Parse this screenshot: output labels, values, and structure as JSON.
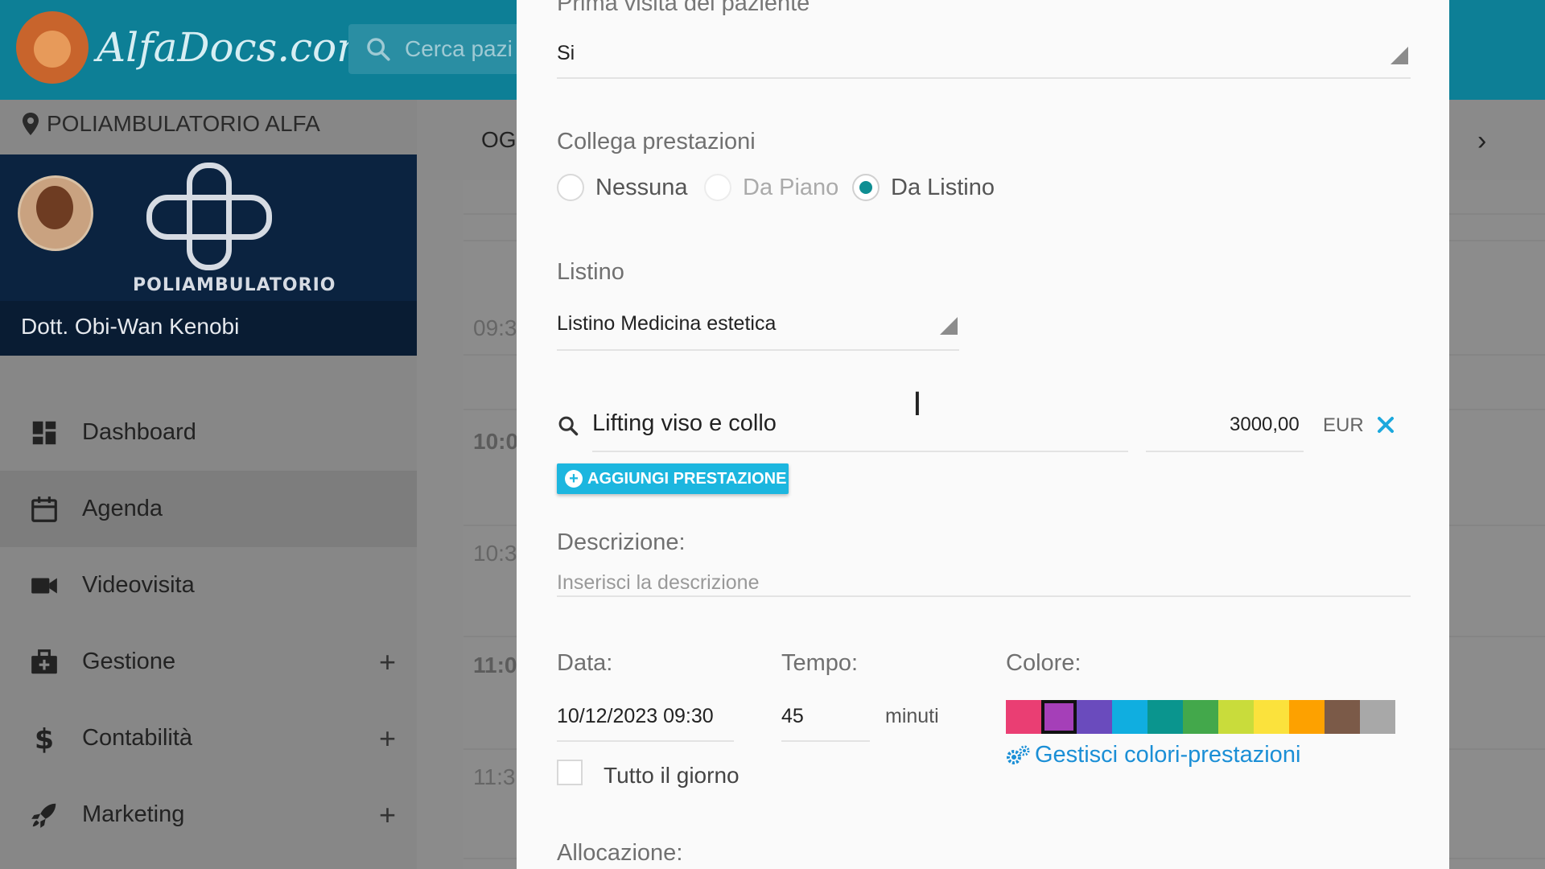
{
  "app": {
    "brand": "AlfaDocs.com",
    "search_placeholder": "Cerca pazi",
    "location": "POLIAMBULATORIO ALFA",
    "clinic_logo_text": "POLIAMBULATORIO",
    "doctor": "Dott. Obi-Wan Kenobi",
    "tab_today": "OGG",
    "nav": [
      {
        "label": "Dashboard",
        "icon": "dashboard-icon"
      },
      {
        "label": "Agenda",
        "icon": "calendar-icon"
      },
      {
        "label": "Videovisita",
        "icon": "video-icon"
      },
      {
        "label": "Gestione",
        "icon": "medical-bag-icon"
      },
      {
        "label": "Contabilità",
        "icon": "dollar-icon"
      },
      {
        "label": "Marketing",
        "icon": "rocket-icon"
      }
    ],
    "times": [
      "09:3",
      "10:0",
      "10:3",
      "11:0",
      "11:3"
    ]
  },
  "form": {
    "first_visit_label": "Prima visita del paziente",
    "first_visit_value": "Si",
    "link_services_label": "Collega prestazioni",
    "radio_options": [
      "Nessuna",
      "Da Piano",
      "Da Listino"
    ],
    "radio_selected": "Da Listino",
    "pricelist_label": "Listino",
    "pricelist_value": "Listino Medicina estetica",
    "service_name": "Lifting viso e collo",
    "service_price": "3000,00",
    "service_currency": "EUR",
    "add_service_button": "AGGIUNGI PRESTAZIONE",
    "description_label": "Descrizione:",
    "description_placeholder": "Inserisci la descrizione",
    "date_label": "Data:",
    "date_value": "10/12/2023 09:30",
    "time_label": "Tempo:",
    "time_value": "45",
    "time_unit": "minuti",
    "color_label": "Colore:",
    "colors": [
      "#ea3e73",
      "#a53fb8",
      "#6a4bbd",
      "#10aee0",
      "#0a958e",
      "#43a84b",
      "#c9dc3b",
      "#fbe23c",
      "#fda100",
      "#7b5a48",
      "#a8a8a8"
    ],
    "selected_color": "#a53fb8",
    "all_day_label": "Tutto il giorno",
    "manage_colors_link": "Gestisci colori-prestazioni",
    "allocation_label": "Allocazione:"
  }
}
